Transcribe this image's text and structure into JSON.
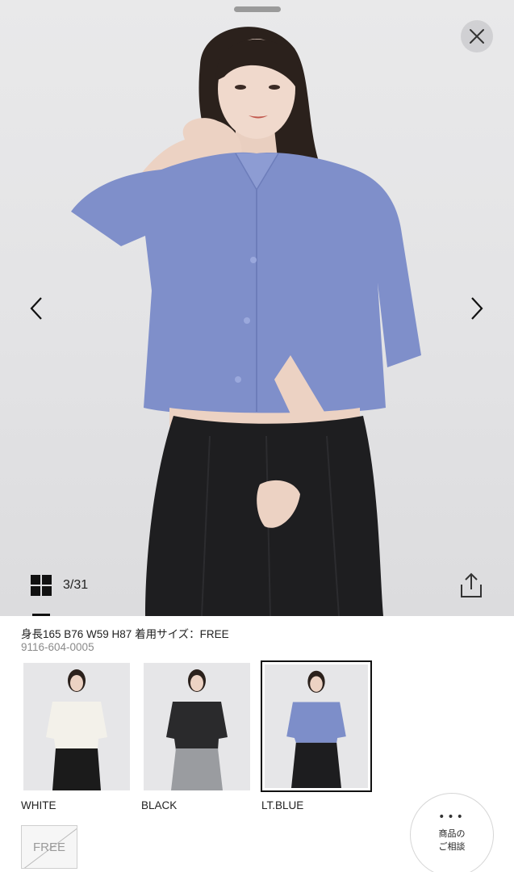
{
  "viewer": {
    "counter": "3/31",
    "icons": {
      "close": "close-icon",
      "prev": "chevron-left-icon",
      "next": "chevron-right-icon",
      "grid": "grid-icon",
      "share": "share-icon"
    }
  },
  "product": {
    "model_info": "身長165 B76 W59 H87 着用サイズ：FREE",
    "sku": "9116-604-0005"
  },
  "colors": [
    {
      "label": "WHITE",
      "shirt": "#f3f1ea",
      "pants": "#1b1b1b",
      "selected": false
    },
    {
      "label": "BLACK",
      "shirt": "#2a2a2c",
      "pants": "#9a9ca0",
      "selected": false
    },
    {
      "label": "LT.BLUE",
      "shirt": "#7d8ec9",
      "pants": "#1d1d1f",
      "selected": true
    }
  ],
  "sizes": [
    {
      "label": "FREE",
      "available": false
    }
  ],
  "consult": {
    "dots": "•••",
    "line1": "商品の",
    "line2": "ご相談"
  },
  "palette": {
    "shirt_blue": "#7f8fca",
    "skirt_black": "#1e1e20",
    "background": "#e6e6e8"
  }
}
